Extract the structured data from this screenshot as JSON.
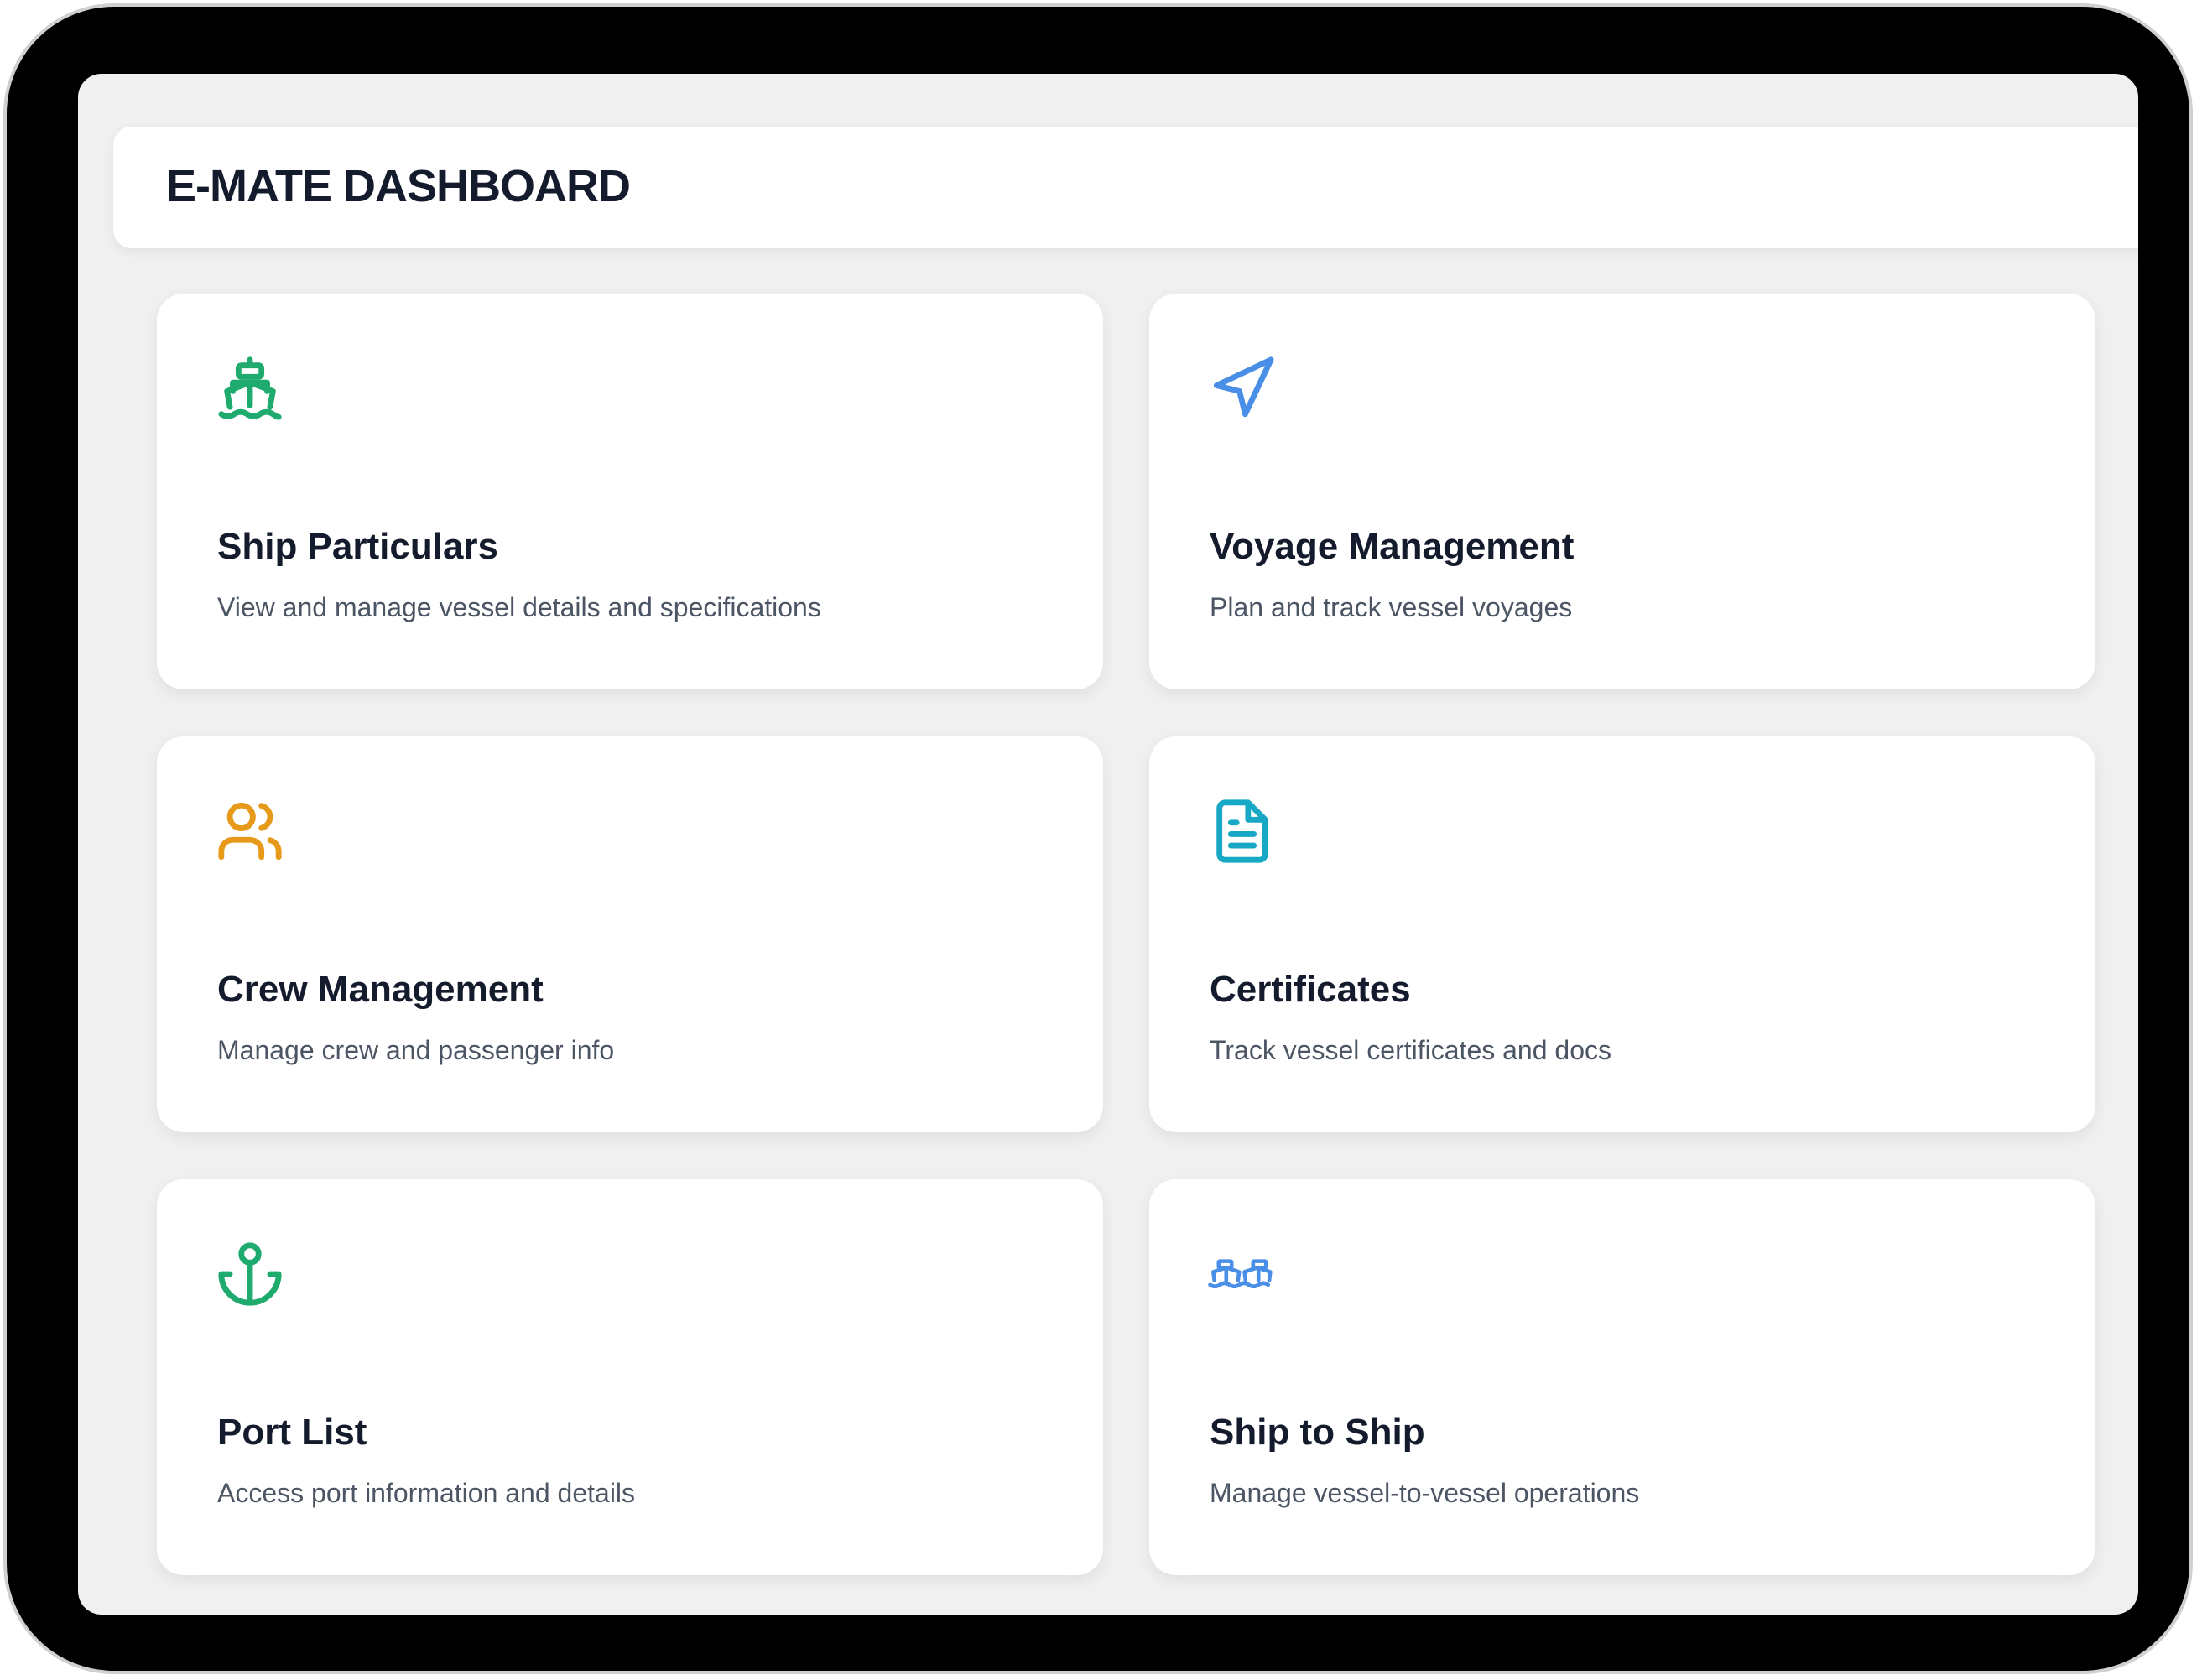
{
  "header": {
    "title": "E-MATE DASHBOARD"
  },
  "cards": [
    {
      "title": "Ship Particulars",
      "description": "View and manage vessel details and specifications",
      "icon": "ship-icon",
      "color": "#1faa6e"
    },
    {
      "title": "Voyage Management",
      "description": "Plan and track vessel voyages",
      "icon": "navigation-arrow-icon",
      "color": "#4a8fe7"
    },
    {
      "title": "Crew Management",
      "description": "Manage crew and passenger info",
      "icon": "users-icon",
      "color": "#e79a1a"
    },
    {
      "title": "Certificates",
      "description": "Track vessel certificates and docs",
      "icon": "document-icon",
      "color": "#16a8c4"
    },
    {
      "title": "Port List",
      "description": "Access port information and details",
      "icon": "anchor-icon",
      "color": "#1faa6e"
    },
    {
      "title": "Ship to Ship",
      "description": "Manage vessel-to-vessel operations",
      "icon": "ships-icon",
      "color": "#4a8fe7"
    }
  ]
}
